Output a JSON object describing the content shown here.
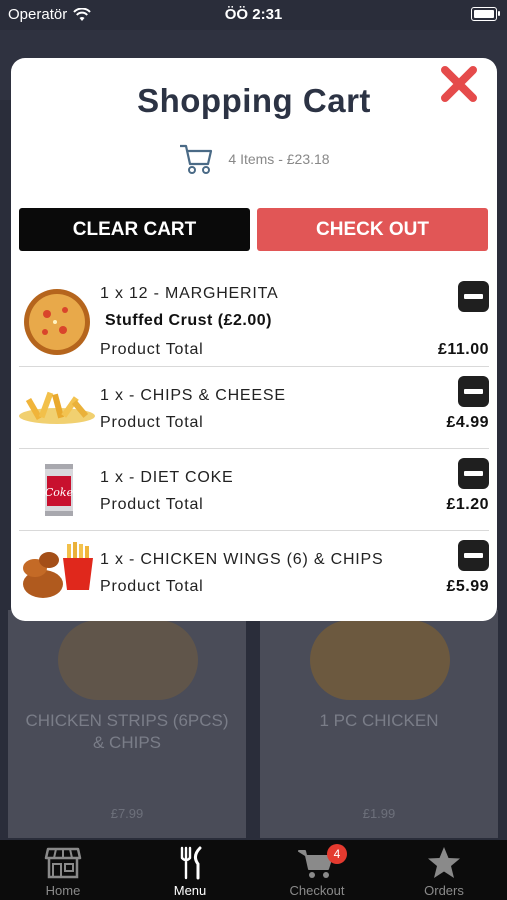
{
  "status_bar": {
    "carrier": "Operatör",
    "time": "ÖÖ 2:31"
  },
  "background_menu": [
    {
      "title": "CHICKEN STRIPS (6PCS) & CHIPS",
      "price": "£7.99"
    },
    {
      "title": "1 PC CHICKEN",
      "price": "£1.99"
    }
  ],
  "cart": {
    "title": "Shopping Cart",
    "summary": "4 Items - £23.18",
    "clear_label": "CLEAR CART",
    "checkout_label": "CHECK OUT",
    "items": [
      {
        "name": "1 x 12 - MARGHERITA",
        "extra": "Stuffed Crust (£2.00)",
        "total_label": "Product Total",
        "price": "£11.00",
        "icon": "pizza-icon"
      },
      {
        "name": "1 x - CHIPS & CHEESE",
        "total_label": "Product Total",
        "price": "£4.99",
        "icon": "chips-icon"
      },
      {
        "name": "1 x - DIET COKE",
        "total_label": "Product Total",
        "price": "£1.20",
        "icon": "coke-can-icon"
      },
      {
        "name": "1 x - CHICKEN WINGS (6) & CHIPS",
        "total_label": "Product Total",
        "price": "£5.99",
        "icon": "chicken-wings-icon"
      }
    ]
  },
  "tabs": [
    {
      "label": "Home",
      "icon": "store-icon",
      "active": false
    },
    {
      "label": "Menu",
      "icon": "fork-knife-icon",
      "active": true
    },
    {
      "label": "Checkout",
      "icon": "cart-icon",
      "active": false,
      "badge": "4"
    },
    {
      "label": "Orders",
      "icon": "star-icon",
      "active": false
    }
  ],
  "colors": {
    "accent_red": "#e15656",
    "dark": "#0a0a0a",
    "title": "#2c3344"
  }
}
